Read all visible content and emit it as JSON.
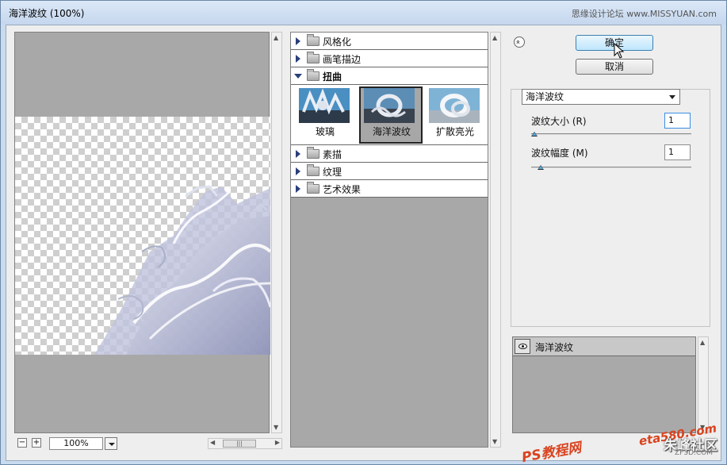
{
  "window": {
    "title": "海洋波纹 (100%)",
    "watermark": "思缘设计论坛 www.MISSYUAN.com"
  },
  "preview": {
    "zoom_out": "−",
    "zoom_in": "+",
    "zoom_value": "100%",
    "scroll_grip": "|||"
  },
  "filter_list": {
    "categories": [
      {
        "label": "风格化",
        "expanded": false
      },
      {
        "label": "画笔描边",
        "expanded": false
      },
      {
        "label": "扭曲",
        "expanded": true
      },
      {
        "label": "素描",
        "expanded": false
      },
      {
        "label": "纹理",
        "expanded": false
      },
      {
        "label": "艺术效果",
        "expanded": false
      }
    ],
    "thumbnails": [
      {
        "label": "玻璃",
        "selected": false
      },
      {
        "label": "海洋波纹",
        "selected": true
      },
      {
        "label": "扩散亮光",
        "selected": false
      }
    ]
  },
  "buttons": {
    "ok": "确定",
    "cancel": "取消",
    "collapse": "»"
  },
  "settings": {
    "filter_select": "海洋波纹",
    "params": [
      {
        "label": "波纹大小 (R)",
        "value": "1",
        "slider_fraction": 0.0
      },
      {
        "label": "波纹幅度 (M)",
        "value": "1",
        "slider_fraction": 0.05
      }
    ]
  },
  "layers": {
    "items": [
      {
        "name": "海洋波纹",
        "visible": true
      }
    ]
  },
  "bottom_watermark": {
    "a": "PS教程网",
    "b": "eta580.com",
    "c": "朱峰社区",
    "d": "ZF3D.COM"
  },
  "colors": {
    "accent": "#3c7fb1",
    "panel_gray": "#a8a8a8",
    "selected_border": "#222222"
  }
}
